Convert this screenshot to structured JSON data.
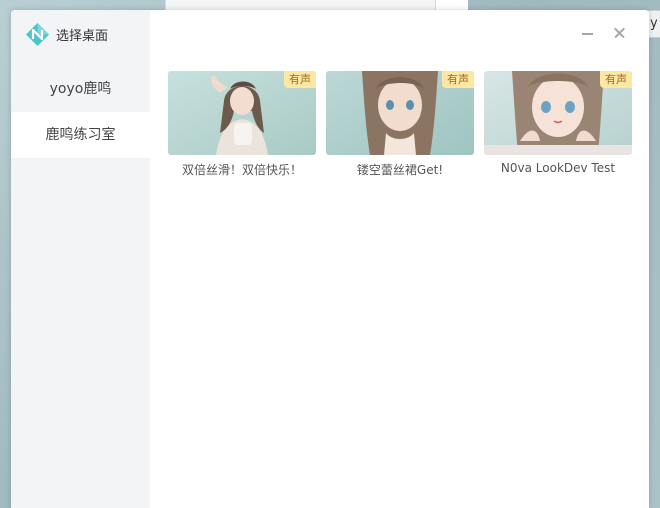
{
  "desktop": {
    "edge_tab_text": "y"
  },
  "app": {
    "title": "选择桌面"
  },
  "sidebar": {
    "items": [
      {
        "label": "yoyo鹿鸣"
      },
      {
        "label": "鹿鸣练习室"
      }
    ]
  },
  "window_controls": {
    "minimize_icon": "minus-icon",
    "close_icon": "close-icon"
  },
  "cards": [
    {
      "title": "双倍丝滑！双倍快乐！",
      "badge": "有声"
    },
    {
      "title": "镂空蕾丝裙Get!",
      "badge": "有声"
    },
    {
      "title": "N0va LookDev Test",
      "badge": "有声"
    }
  ],
  "colors": {
    "accent": "#4ec3c9",
    "badge_bg": "#fde7a4",
    "badge_text": "#a16b1c",
    "sidebar_bg": "#f3f4f6"
  }
}
